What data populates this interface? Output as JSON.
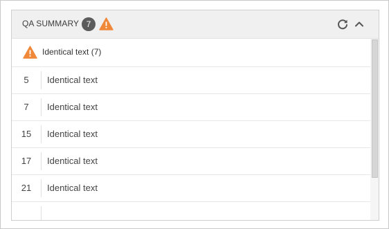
{
  "panel": {
    "title": "QA SUMMARY",
    "issue_count": "7",
    "accent_colors": {
      "warning": "#F0883A",
      "badge": "#5C5C5C"
    },
    "header_icons": [
      "warning-icon",
      "refresh-icon",
      "chevron-up-icon"
    ]
  },
  "group": {
    "icon": "warning-icon",
    "label": "Identical text (7)"
  },
  "rows": [
    {
      "num": "5",
      "text": "Identical text"
    },
    {
      "num": "7",
      "text": "Identical text"
    },
    {
      "num": "15",
      "text": "Identical text"
    },
    {
      "num": "17",
      "text": "Identical text"
    },
    {
      "num": "21",
      "text": "Identical text"
    }
  ]
}
